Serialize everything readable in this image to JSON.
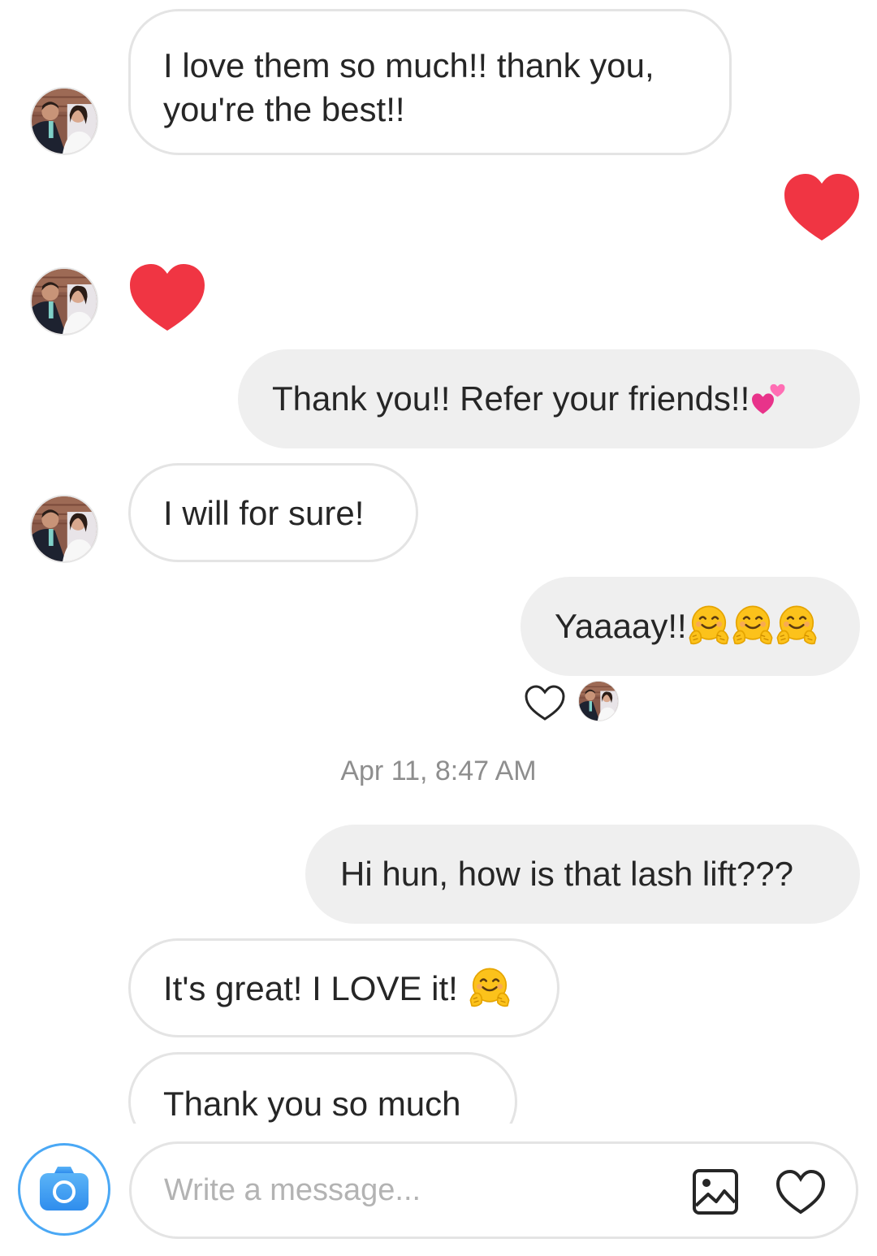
{
  "thread": {
    "messages": [
      {
        "sender": "them",
        "lines": [
          "I love them so much!! thank you,",
          "you're the best!!"
        ]
      },
      {
        "sender": "me",
        "type": "heart",
        "color": "#f03543"
      },
      {
        "sender": "them",
        "type": "heart",
        "color": "#f03543"
      },
      {
        "sender": "me",
        "text": "Thank you!! Refer your friends!!",
        "emoji": "two-hearts"
      },
      {
        "sender": "them",
        "text": "I will for sure!"
      },
      {
        "sender": "me",
        "text": "Yaaaay!!",
        "emoji": "hugging-face x3"
      },
      {
        "sender": "me",
        "text": "Hi hun, how is that lash lift???"
      },
      {
        "sender": "them",
        "text": "It's great! I LOVE it!",
        "emoji": "hugging-face"
      },
      {
        "sender": "them",
        "text": "Thank you so much"
      }
    ],
    "timestamp": "Apr 11, 8:47 AM",
    "seen_by": "contact-avatar"
  },
  "composer": {
    "placeholder": "Write a message...",
    "value": "",
    "gallery_icon": "image-icon",
    "like_icon": "heart-outline-icon",
    "camera_icon": "camera-icon"
  },
  "colors": {
    "heart": "#f03543",
    "outgoing_bubble": "#efefef",
    "incoming_border": "#e4e4e4",
    "camera_blue": "#3f9bf2",
    "timestamp": "#8e8e8e"
  }
}
